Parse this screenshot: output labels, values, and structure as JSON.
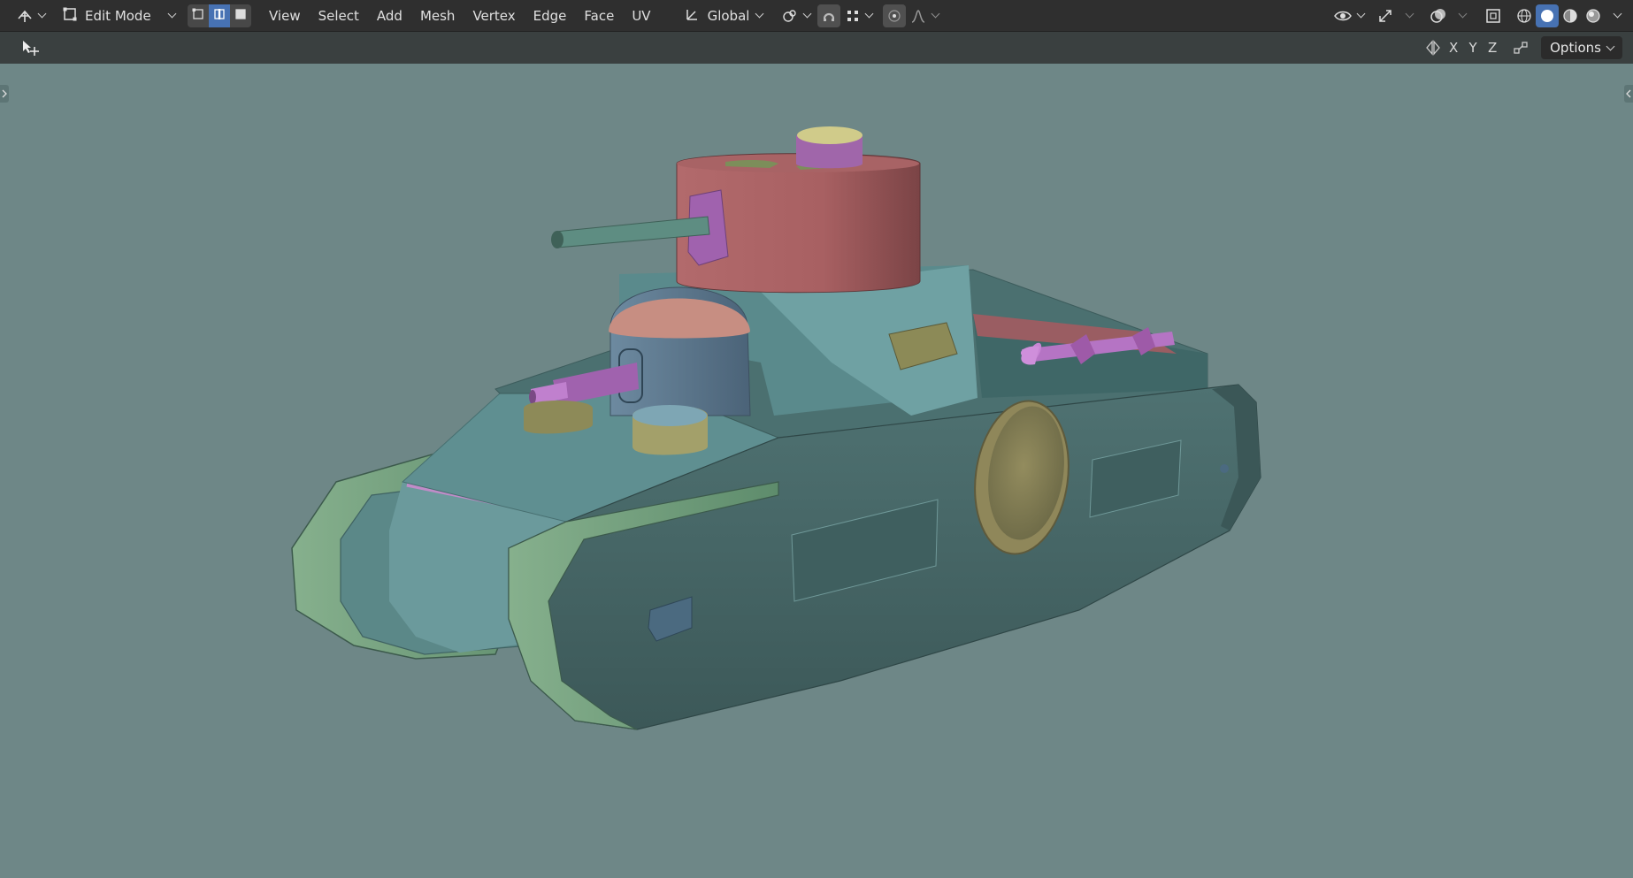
{
  "header": {
    "editor_type_icon": "editor-type-icon",
    "mode": {
      "label": "Edit Mode",
      "icon": "edit-mode-icon"
    },
    "select_modes": [
      {
        "name": "vertex-select-icon",
        "active": false
      },
      {
        "name": "edge-select-icon",
        "active": true
      },
      {
        "name": "face-select-icon",
        "active": false
      }
    ],
    "menus": [
      "View",
      "Select",
      "Add",
      "Mesh",
      "Vertex",
      "Edge",
      "Face",
      "UV"
    ],
    "transform_orientation": {
      "label": "Global",
      "icon": "orientation-icon"
    },
    "pivot_icon": "pivot-point-icon",
    "snap_icon": "snap-icon",
    "snap_target_icon": "snap-increment-icon",
    "proportional_icon": "proportional-edit-icon",
    "falloff_icon": "falloff-icon",
    "right_icons": [
      "visibility-icon",
      "gizmo-icon",
      "overlay-icon",
      "xray-icon"
    ],
    "shading_modes": [
      {
        "name": "wireframe-shading-icon",
        "active": false
      },
      {
        "name": "solid-shading-icon",
        "active": true
      },
      {
        "name": "material-shading-icon",
        "active": false
      },
      {
        "name": "rendered-shading-icon",
        "active": false
      }
    ]
  },
  "toolbar2": {
    "tool_icon": "transform-tool-icon",
    "mirror_icon": "mirror-icon",
    "axes": [
      "X",
      "Y",
      "Z"
    ],
    "auto_merge_icon": "auto-merge-icon",
    "options_label": "Options"
  },
  "colors": {
    "header_bg": "#2f2f2f",
    "toolbar_bg": "#3a4040",
    "viewport_bg": "#6e8787",
    "accent": "#4772b3"
  },
  "viewport": {
    "object": "tank-model"
  }
}
